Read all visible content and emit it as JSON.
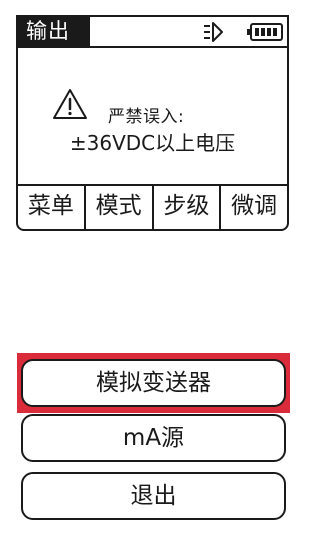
{
  "screen": {
    "mode_label": "输出",
    "status_icons": [
      "probe-icon",
      "battery-icon"
    ],
    "warning": {
      "icon": "warning-triangle-icon",
      "line1": "严禁误入:",
      "line2": "±36VDC以上电压"
    },
    "softkeys": [
      "菜单",
      "模式",
      "步级",
      "微调"
    ]
  },
  "menu": {
    "items": [
      "模拟变送器",
      "mA源",
      "退出"
    ],
    "selected_index": 0,
    "selection_color": "#d92b3a"
  }
}
